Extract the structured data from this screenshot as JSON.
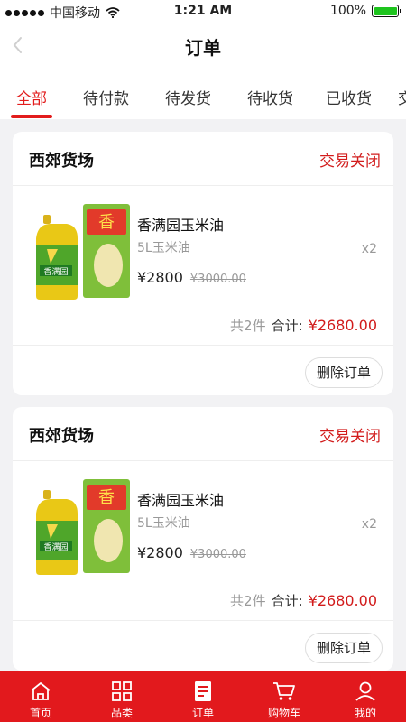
{
  "status_bar": {
    "carrier": "中国移动",
    "time": "1:21 AM",
    "battery": "100%",
    "battery_level": 1.0
  },
  "header": {
    "title": "订单",
    "back_icon": "chevron-left-icon"
  },
  "tabs": [
    {
      "label": "全部",
      "active": true
    },
    {
      "label": "待付款"
    },
    {
      "label": "待发货"
    },
    {
      "label": "待收货"
    },
    {
      "label": "已收货"
    },
    {
      "label": "交"
    }
  ],
  "orders": [
    {
      "shop": "西郊货场",
      "status": "交易关闭",
      "product": {
        "name": "香满园玉米油",
        "spec": "5L玉米油",
        "qty": "x2",
        "price": "¥2800",
        "original_price": "¥3000.00"
      },
      "count_text": "共2件",
      "total_label": "合计:",
      "total": "¥2680.00",
      "delete_label": "删除订单"
    },
    {
      "shop": "西郊货场",
      "status": "交易关闭",
      "product": {
        "name": "香满园玉米油",
        "spec": "5L玉米油",
        "qty": "x2",
        "price": "¥2800",
        "original_price": "¥3000.00"
      },
      "count_text": "共2件",
      "total_label": "合计:",
      "total": "¥2680.00",
      "delete_label": "删除订单"
    }
  ],
  "tab_bar": [
    {
      "label": "首页",
      "icon": "home-icon"
    },
    {
      "label": "品类",
      "icon": "grid-icon"
    },
    {
      "label": "订单",
      "icon": "order-list-icon",
      "active": true
    },
    {
      "label": "购物车",
      "icon": "cart-icon"
    },
    {
      "label": "我的",
      "icon": "user-icon"
    }
  ],
  "colors": {
    "accent": "#e2191d",
    "status_red": "#d21c1c"
  }
}
